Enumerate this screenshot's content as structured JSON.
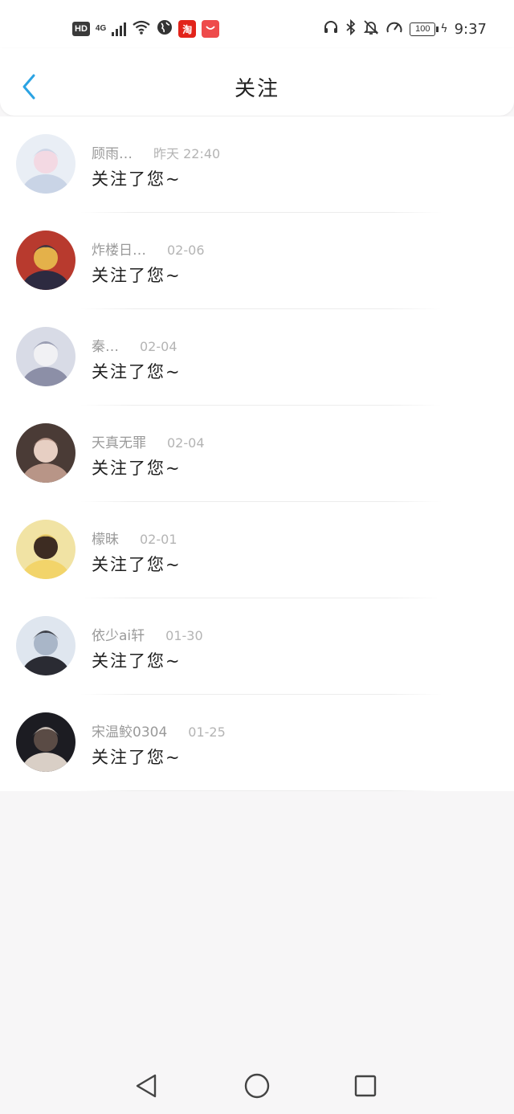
{
  "status_bar": {
    "hd": "HD",
    "network": "4G",
    "taobao_badge": "淘",
    "time": "9:37",
    "battery": "100"
  },
  "header": {
    "title": "关注"
  },
  "follows": [
    {
      "name": "顾雨…",
      "time": "昨天 22:40",
      "message": "关注了您~",
      "avatar_colors": [
        "#e9eef5",
        "#c9d4e6",
        "#f3d9e3"
      ]
    },
    {
      "name": "炸楼日…",
      "time": "02-06",
      "message": "关注了您~",
      "avatar_colors": [
        "#b83a2e",
        "#2d2a40",
        "#e4b14a"
      ]
    },
    {
      "name": "秦…",
      "time": "02-04",
      "message": "关注了您~",
      "avatar_colors": [
        "#d8dbe6",
        "#8c8fa7",
        "#f1f1f4"
      ]
    },
    {
      "name": "天真无罪",
      "time": "02-04",
      "message": "关注了您~",
      "avatar_colors": [
        "#4a3b36",
        "#b89587",
        "#e7cfc3"
      ]
    },
    {
      "name": "檬昧",
      "time": "02-01",
      "message": "关注了您~",
      "avatar_colors": [
        "#f1e3a4",
        "#f2d46a",
        "#3d2c22"
      ]
    },
    {
      "name": "依少ai轩",
      "time": "01-30",
      "message": "关注了您~",
      "avatar_colors": [
        "#dfe6ef",
        "#2a2b33",
        "#a9b6c8"
      ]
    },
    {
      "name": "宋温鲛0304",
      "time": "01-25",
      "message": "关注了您~",
      "avatar_colors": [
        "#1c1c22",
        "#d9cfc6",
        "#5a4b45"
      ]
    }
  ],
  "colors": {
    "accent": "#2ba3e3",
    "background": "#f7f6f7"
  }
}
